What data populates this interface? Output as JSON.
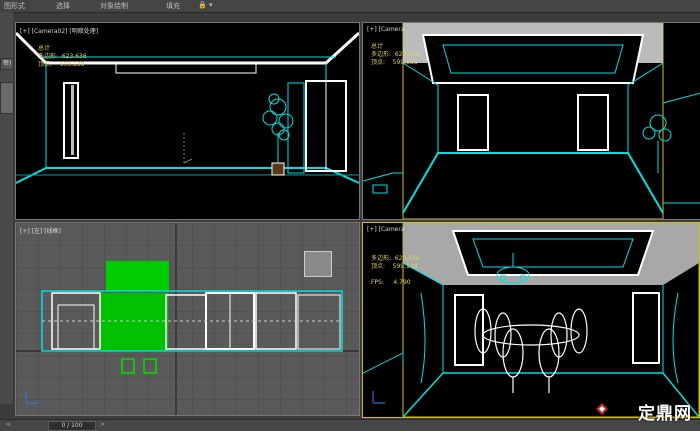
{
  "menu": [
    "图形式",
    "选择",
    "对象绘制",
    "填充",
    "🔒 ▾"
  ],
  "side_tabs": [
    "帝)"
  ],
  "viewports": {
    "top_left": {
      "label": "[+] [Camera02] [明暗处理]",
      "stats": [
        "总计",
        "多边形:  623,636",
        "顶点:    599,138"
      ]
    },
    "top_right": {
      "label": "[+] [Camera",
      "stats": [
        "总计",
        "多边形:  623,636",
        "顶点:    599,138"
      ]
    },
    "bottom_left": {
      "label": "[+] [左] [线框]"
    },
    "bottom_right": {
      "label": "[+] [Camera",
      "stats": [
        "多边形:  623,636",
        "顶点:    599,138",
        "",
        "FPS:     4.790"
      ]
    }
  },
  "status": {
    "timeline": "0 / 100"
  },
  "watermark": {
    "text": "定鼎网"
  },
  "colors": {
    "wire": "#00e0e0",
    "white": "#ffffff",
    "green": "#00cc00",
    "yellow": "#ffd700",
    "bg": "#000000"
  }
}
